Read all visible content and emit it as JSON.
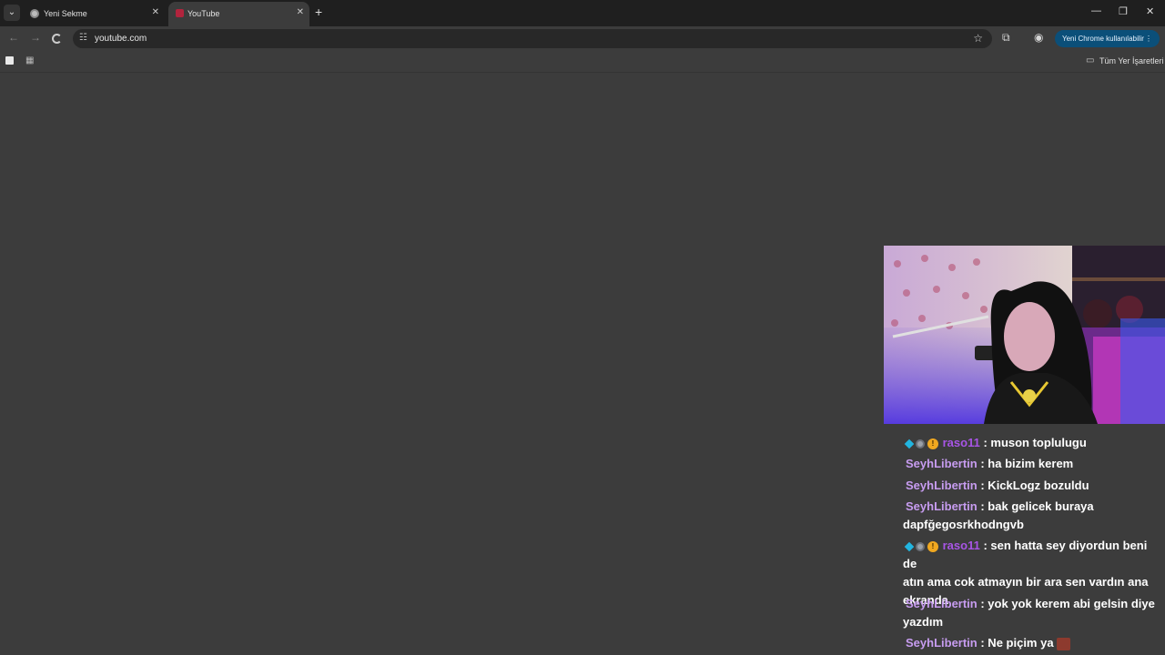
{
  "browser": {
    "tabs": [
      {
        "label": "Yeni Sekme",
        "active": false
      },
      {
        "label": "YouTube",
        "active": true
      }
    ],
    "address": "youtube.com",
    "update_button": "Yeni Chrome kullanılabilir",
    "all_bookmarks": "Tüm Yer İşaretleri"
  },
  "chat": {
    "messages": [
      {
        "user": "raso11",
        "text": " : muson toplulugu",
        "badges": true,
        "user_color": "#a855e6"
      },
      {
        "user": "SeyhLibertin",
        "text": " : ha bizim kerem"
      },
      {
        "user": "SeyhLibertin",
        "text": " : KickLogz bozuldu"
      },
      {
        "user": "SeyhLibertin",
        "text": " : bak gelicek buraya",
        "text2": "dapfğegosrkhodngvb"
      },
      {
        "user": "raso11",
        "text": " : sen hatta sey diyordun beni de",
        "text2": "atın ama cok atmayın bir ara sen vardın ana",
        "text3": "ekranda",
        "badges": true,
        "user_color": "#a855e6"
      },
      {
        "user": "SeyhLibertin",
        "text": " : yok yok kerem abi gelsin diye",
        "text2": "yazdım"
      },
      {
        "user": "SeyhLibertin",
        "text": " : Ne piçim ya"
      }
    ]
  }
}
